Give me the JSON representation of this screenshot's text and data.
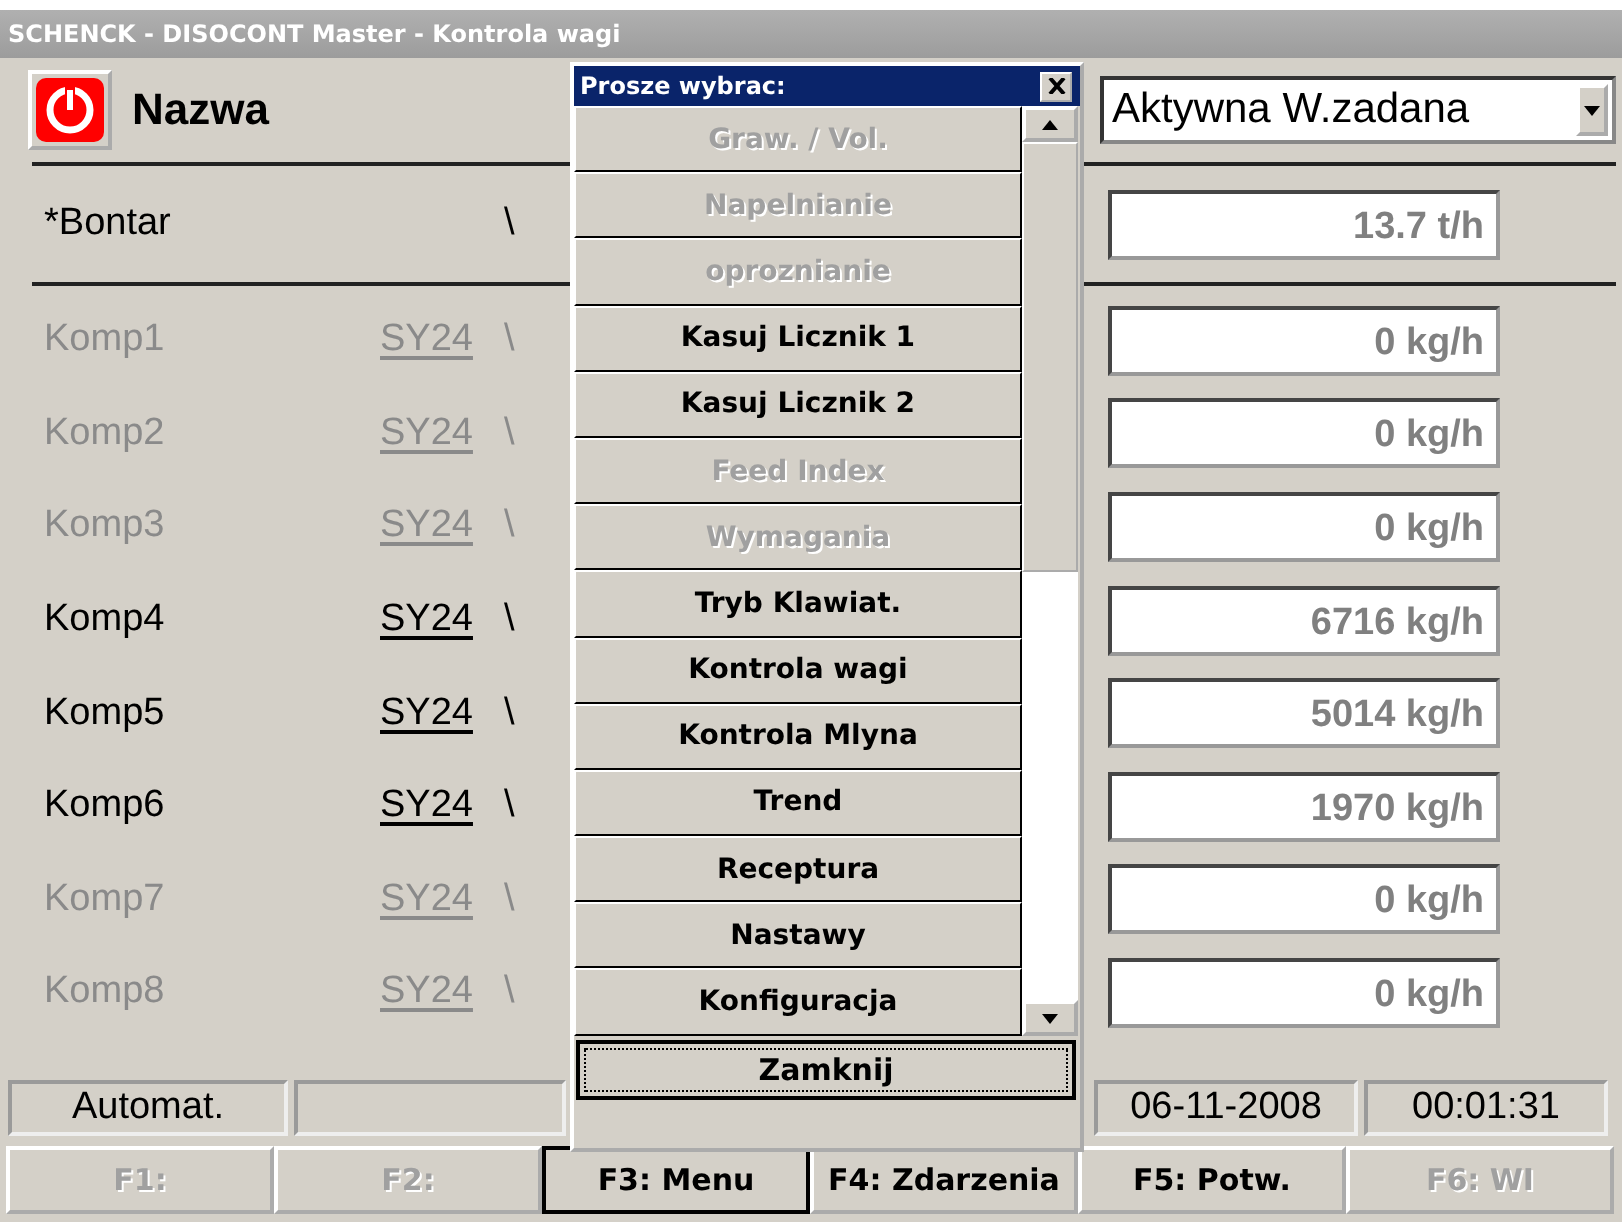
{
  "window": {
    "title": "SCHENCK - DISOCONT Master - Kontrola wagi"
  },
  "header": {
    "title": "Nazwa",
    "dropdown": {
      "value": "Aktywna W.zadana"
    }
  },
  "total": {
    "name": "*Bontar",
    "column_3": "\\",
    "value": "13.7 t/h"
  },
  "components": [
    {
      "name": "Komp1",
      "device": "SY24",
      "column_3": "\\",
      "value": "0 kg/h",
      "active": false
    },
    {
      "name": "Komp2",
      "device": "SY24",
      "column_3": "\\",
      "value": "0 kg/h",
      "active": false
    },
    {
      "name": "Komp3",
      "device": "SY24",
      "column_3": "\\",
      "value": "0 kg/h",
      "active": false
    },
    {
      "name": "Komp4",
      "device": "SY24",
      "column_3": "\\",
      "value": "6716 kg/h",
      "active": true
    },
    {
      "name": "Komp5",
      "device": "SY24",
      "column_3": "\\",
      "value": "5014 kg/h",
      "active": true
    },
    {
      "name": "Komp6",
      "device": "SY24",
      "column_3": "\\",
      "value": "1970 kg/h",
      "active": true
    },
    {
      "name": "Komp7",
      "device": "SY24",
      "column_3": "\\",
      "value": "0 kg/h",
      "active": false
    },
    {
      "name": "Komp8",
      "device": "SY24",
      "column_3": "\\",
      "value": "0 kg/h",
      "active": false
    }
  ],
  "menu": {
    "title": "Prosze wybrac:",
    "items": [
      {
        "label": "Graw. / Vol.",
        "disabled": true
      },
      {
        "label": "Napelnianie",
        "disabled": true
      },
      {
        "label": "oproznianie",
        "disabled": true
      },
      {
        "label": "Kasuj Licznik 1",
        "disabled": false
      },
      {
        "label": "Kasuj Licznik 2",
        "disabled": false
      },
      {
        "label": "Feed Index",
        "disabled": true
      },
      {
        "label": "Wymagania",
        "disabled": true
      },
      {
        "label": "Tryb Klawiat.",
        "disabled": false
      },
      {
        "label": "Kontrola wagi",
        "disabled": false
      },
      {
        "label": "Kontrola Mlyna",
        "disabled": false
      },
      {
        "label": "Trend",
        "disabled": false
      },
      {
        "label": "Receptura",
        "disabled": false
      },
      {
        "label": "Nastawy",
        "disabled": false
      },
      {
        "label": "Konfiguracja",
        "disabled": false
      }
    ],
    "close_button": "Zamknij"
  },
  "status_bar": {
    "mode": "Automat.",
    "date": "06-11-2008",
    "time": "00:01:31"
  },
  "function_keys": [
    {
      "label": "F1:",
      "disabled": true,
      "selected": false
    },
    {
      "label": "F2:",
      "disabled": true,
      "selected": false
    },
    {
      "label": "F3: Menu",
      "disabled": false,
      "selected": true
    },
    {
      "label": "F4: Zdarzenia",
      "disabled": false,
      "selected": false
    },
    {
      "label": "F5: Potw.",
      "disabled": false,
      "selected": false
    },
    {
      "label": "F6: WI",
      "disabled": true,
      "selected": false
    }
  ]
}
